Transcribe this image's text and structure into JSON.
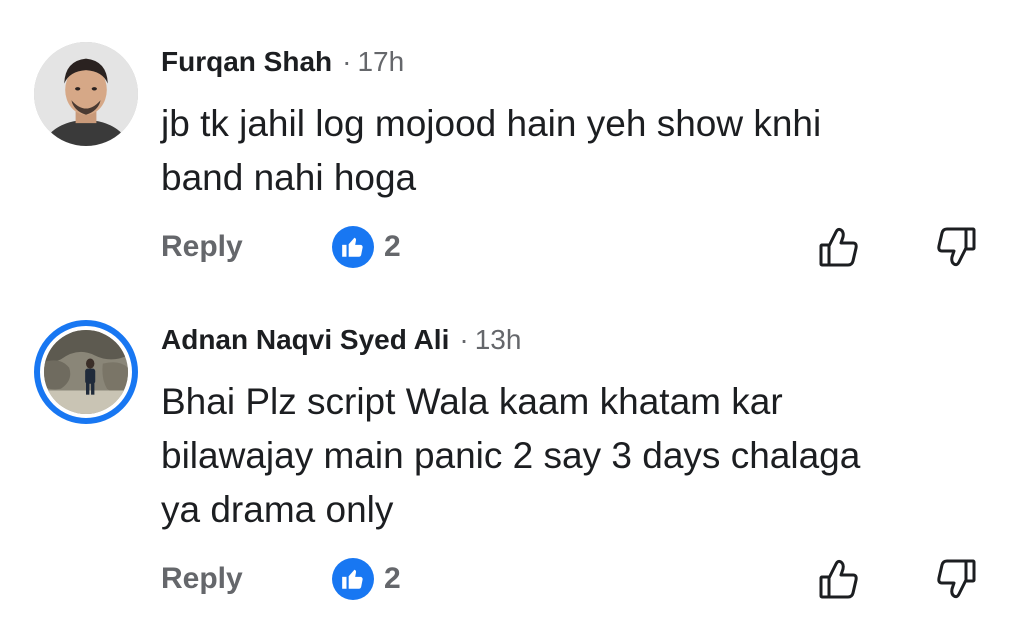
{
  "comments": [
    {
      "author": "Furqan Shah",
      "separator": "·",
      "time": "17h",
      "lines": [
        "jb tk jahil log mojood hain yeh show knhi",
        "band nahi hoga"
      ],
      "reply_label": "Reply",
      "like_count": "2",
      "like_icon": "thumbs-up-icon",
      "upvote_icon": "upvote-icon",
      "downvote_icon": "downvote-icon"
    },
    {
      "author": "Adnan Naqvi Syed Ali",
      "separator": "·",
      "time": "13h",
      "lines": [
        "Bhai Plz script Wala kaam khatam kar",
        "bilawajay main panic 2 say 3 days chalaga",
        "ya drama only"
      ],
      "reply_label": "Reply",
      "like_count": "2",
      "like_icon": "thumbs-up-icon",
      "upvote_icon": "upvote-icon",
      "downvote_icon": "downvote-icon",
      "story_ring": true
    }
  ],
  "colors": {
    "accent": "#1877f2",
    "secondary_text": "#65676b",
    "primary_text": "#1c1e21"
  }
}
